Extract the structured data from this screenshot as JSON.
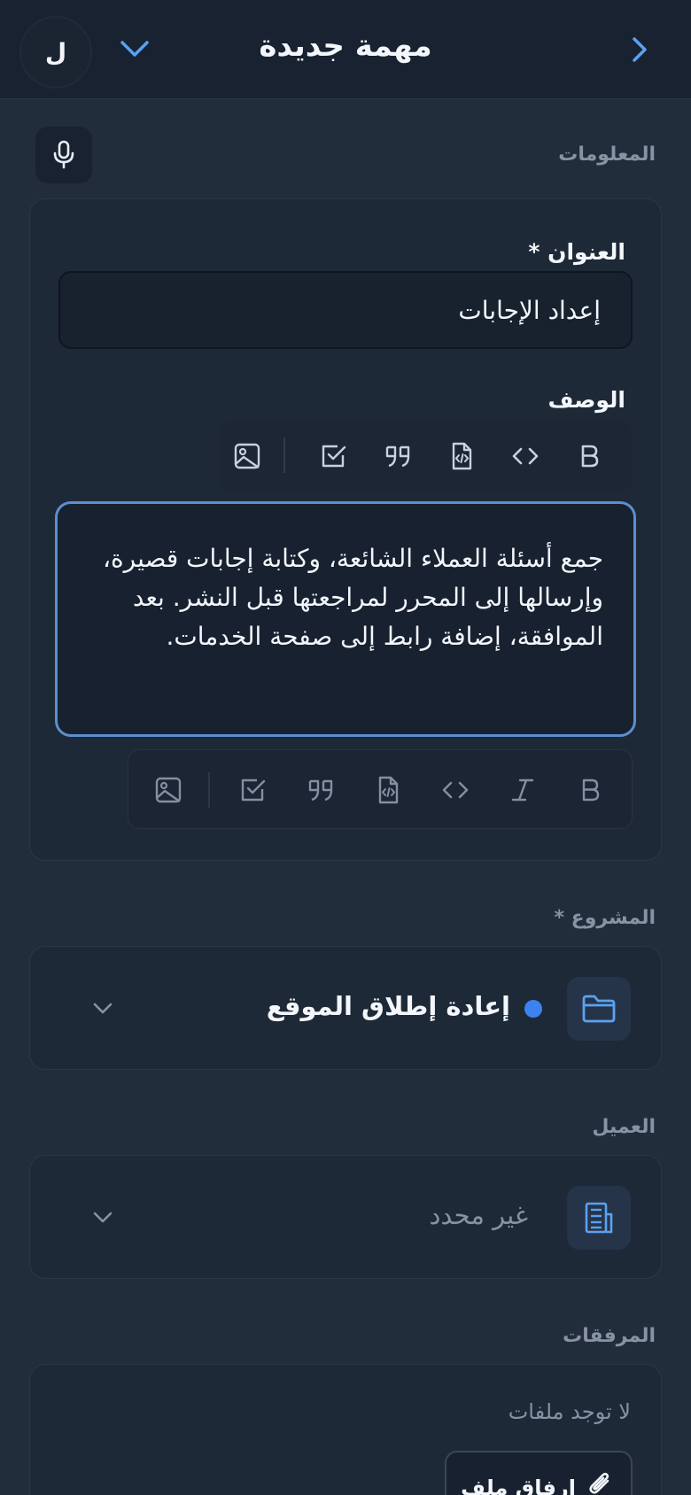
{
  "header": {
    "title": "مهمة جديدة",
    "avatar_initial": "ل"
  },
  "info": {
    "section_label": "المعلومات",
    "title_label": "العنوان *",
    "title_value": "إعداد الإجابات",
    "description_label": "الوصف",
    "description_value": "جمع أسئلة العملاء الشائعة، وكتابة إجابات قصيرة، وإرسالها إلى المحرر لمراجعتها قبل النشر. بعد الموافقة، إضافة رابط إلى صفحة الخدمات."
  },
  "project": {
    "section_label": "المشروع *",
    "value": "إعادة إطلاق الموقع",
    "dot_color": "#3d83f0"
  },
  "client": {
    "section_label": "العميل",
    "value": "غير محدد"
  },
  "attachments": {
    "section_label": "المرفقات",
    "empty_text": "لا توجد ملفات",
    "attach_button_label": "إرفاق ملف"
  },
  "toolbar_icons": [
    "bold-icon",
    "code-icon",
    "code-file-icon",
    "quote-icon",
    "checkbox-icon",
    "image-icon"
  ],
  "toolbar2_icons": [
    "bold-icon",
    "italic-icon",
    "code-icon",
    "code-file-icon",
    "quote-icon",
    "checkbox-icon",
    "image-icon"
  ],
  "colors": {
    "accent": "#5b8fd0",
    "background": "#222d3c",
    "header": "#182230"
  }
}
